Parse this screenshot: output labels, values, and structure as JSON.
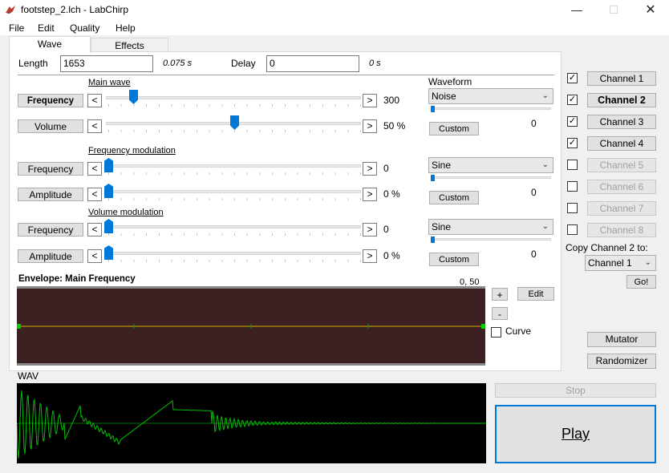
{
  "window": {
    "title": "footstep_2.lch - LabChirp",
    "minimize_icon": "minimize-icon",
    "maximize_icon": "maximize-icon",
    "close_icon": "close-icon"
  },
  "menu": [
    "File",
    "Edit",
    "Quality",
    "Help"
  ],
  "tabs": [
    {
      "label": "Wave",
      "active": true
    },
    {
      "label": "Effects",
      "active": false
    }
  ],
  "wave": {
    "length_label": "Length",
    "length_value": "1653",
    "length_seconds": "0.075 s",
    "delay_label": "Delay",
    "delay_value": "0",
    "delay_seconds": "0 s",
    "main_wave_heading": "Main wave",
    "freq_mod_heading": "Frequency modulation",
    "vol_mod_heading": "Volume modulation",
    "waveform_heading": "Waveform",
    "rows": [
      {
        "button": "Frequency",
        "bold": true,
        "value": "300",
        "level": 0.1
      },
      {
        "button": "Volume",
        "bold": false,
        "value": "50 %",
        "level": 0.5
      },
      {
        "button": "Frequency",
        "bold": false,
        "value": "0",
        "level": 0.0
      },
      {
        "button": "Amplitude",
        "bold": false,
        "value": "0 %",
        "level": 0.0
      },
      {
        "button": "Frequency",
        "bold": false,
        "value": "0",
        "level": 0.0
      },
      {
        "button": "Amplitude",
        "bold": false,
        "value": "0 %",
        "level": 0.0
      }
    ],
    "left_arrow": "<",
    "right_arrow": ">",
    "waveforms": [
      {
        "selected": "Noise",
        "value": "0",
        "custom": "Custom"
      },
      {
        "selected": "Sine",
        "value": "0",
        "custom": "Custom"
      },
      {
        "selected": "Sine",
        "value": "0",
        "custom": "Custom"
      }
    ]
  },
  "envelope": {
    "title": "Envelope: Main Frequency",
    "coords": "0, 50",
    "plus": "+",
    "minus": "-",
    "edit": "Edit",
    "curve_label": "Curve",
    "curve_checked": false,
    "line_color": "#d9b000"
  },
  "channels": {
    "items": [
      {
        "label": "Channel 1",
        "checked": true,
        "enabled": true,
        "bold": false
      },
      {
        "label": "Channel 2",
        "checked": true,
        "enabled": true,
        "bold": true
      },
      {
        "label": "Channel 3",
        "checked": true,
        "enabled": true,
        "bold": false
      },
      {
        "label": "Channel 4",
        "checked": true,
        "enabled": true,
        "bold": false
      },
      {
        "label": "Channel 5",
        "checked": false,
        "enabled": false,
        "bold": false
      },
      {
        "label": "Channel 6",
        "checked": false,
        "enabled": false,
        "bold": false
      },
      {
        "label": "Channel 7",
        "checked": false,
        "enabled": false,
        "bold": false
      },
      {
        "label": "Channel 8",
        "checked": false,
        "enabled": false,
        "bold": false
      }
    ],
    "copy_label": "Copy Channel 2 to:",
    "copy_target": "Channel 1",
    "go": "Go!",
    "mutator": "Mutator",
    "randomizer": "Randomizer"
  },
  "wav": {
    "label": "WAV",
    "stop": "Stop",
    "play": "Play",
    "wave_color": "#00c000"
  }
}
